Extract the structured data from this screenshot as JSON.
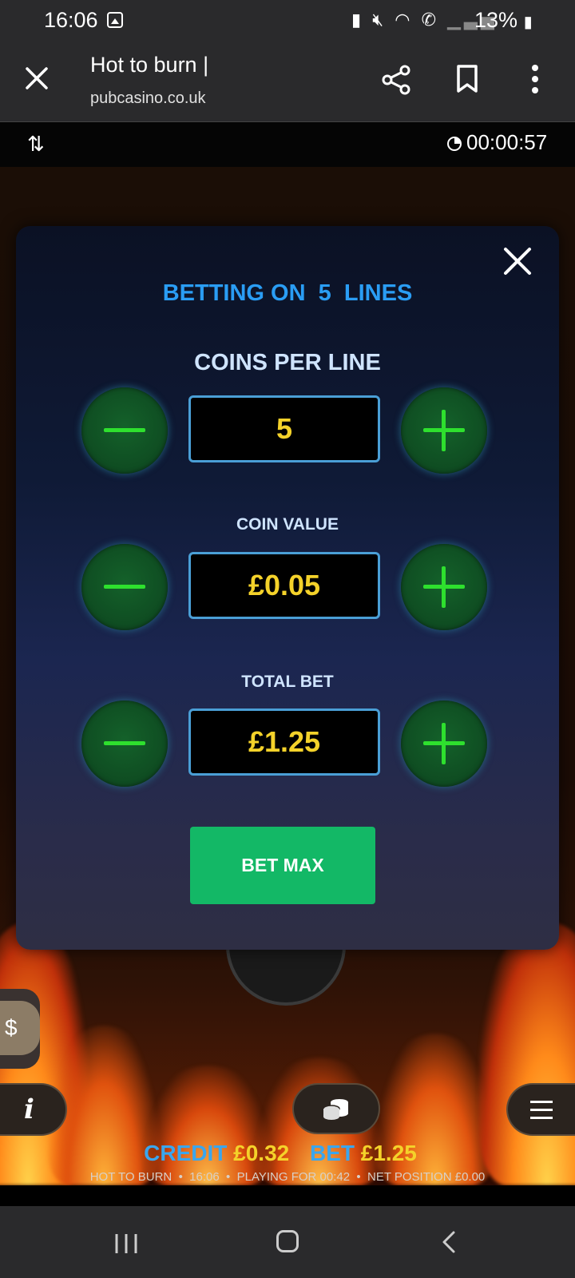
{
  "status_bar": {
    "time": "16:06",
    "battery": "13%",
    "icons": [
      "gallery-icon",
      "battery-saver-icon",
      "mute-icon",
      "wifi-icon",
      "wifi-calling-icon",
      "signal-icon",
      "charging-icon"
    ]
  },
  "browser": {
    "title": "Hot to burn |",
    "url": "pubcasino.co.uk"
  },
  "game_bar": {
    "timer": "00:00:57"
  },
  "modal": {
    "heading": "BETTING ON  5  LINES",
    "coins_per_line_label": "COINS PER LINE",
    "coins_per_line_value": "5",
    "coin_value_label": "COIN VALUE",
    "coin_value": "£0.05",
    "total_bet_label": "TOTAL BET",
    "total_bet_value": "£1.25",
    "bet_max_label": "BET MAX"
  },
  "controls": {
    "dollar_label": "$",
    "info_label": "i"
  },
  "footer": {
    "credit_label": "CREDIT",
    "credit_value": "£0.32",
    "bet_label": "BET",
    "bet_value": "£1.25",
    "ticker": "HOT TO BURN  •  16:06  •  PLAYING FOR 00:42  •  NET POSITION £0.00"
  },
  "colors": {
    "accent_blue": "#2a9df4",
    "value_yellow": "#f4d22a",
    "button_green": "#13b866",
    "stepper_green": "#2ee02e"
  }
}
